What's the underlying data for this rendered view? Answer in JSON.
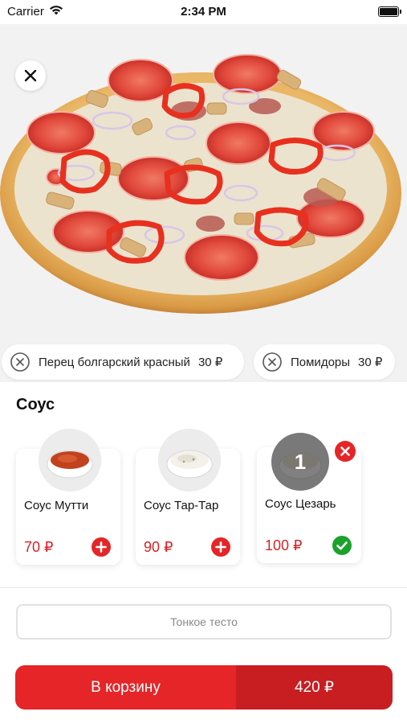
{
  "status_bar": {
    "carrier": "Carrier",
    "time": "2:34 PM"
  },
  "toppings": [
    {
      "label": "Перец болгарский красный",
      "price": "30 ₽"
    },
    {
      "label": "Помидоры",
      "price": "30 ₽"
    }
  ],
  "sauce_section": {
    "title": "Соус",
    "items": [
      {
        "name": "Соус Мутти",
        "price": "70 ₽",
        "state": "add"
      },
      {
        "name": "Соус Тар-Тар",
        "price": "90 ₽",
        "state": "add"
      },
      {
        "name": "Соус Цезарь",
        "price": "100 ₽",
        "state": "selected",
        "quantity": "1"
      }
    ]
  },
  "dough": {
    "selected": "Тонкое тесто"
  },
  "cart": {
    "label": "В корзину",
    "total": "420 ₽"
  },
  "colors": {
    "accent": "#e52528",
    "accent_dark": "#c81e22",
    "success": "#1aa32b",
    "background": "#f2f2f2"
  },
  "icons": [
    "wifi-icon",
    "battery-icon",
    "close-icon",
    "remove-circle-icon",
    "plus-icon",
    "check-icon"
  ]
}
